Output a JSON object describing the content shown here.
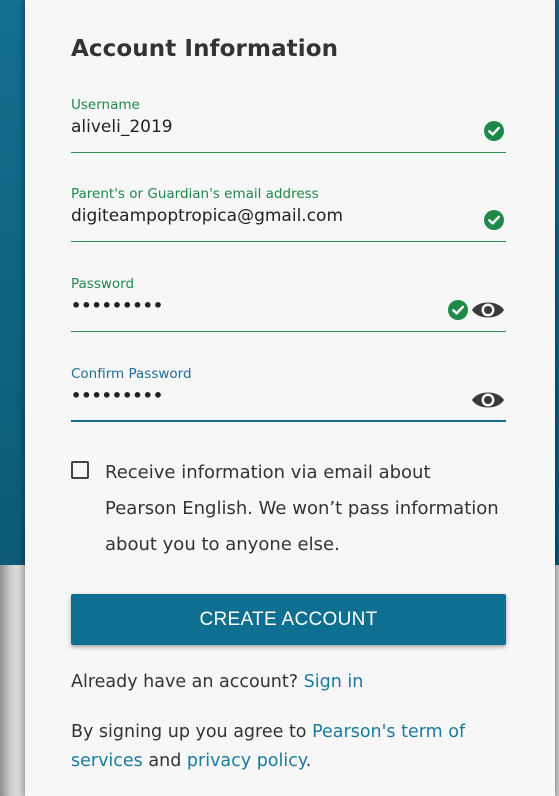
{
  "colors": {
    "accent": "#0f6f91",
    "success": "#1e8a4a",
    "link": "#1a7a9e",
    "background_teal": "#13708f",
    "card": "#f7f7f7"
  },
  "form": {
    "title": "Account Information",
    "username": {
      "label": "Username",
      "value": "aliveli_2019",
      "status_icon": "check-circle-icon"
    },
    "email": {
      "label": "Parent's or Guardian's email address",
      "value": "digiteampoptropica@gmail.com",
      "status_icon": "check-circle-icon"
    },
    "password": {
      "label": "Password",
      "value": "•••••••••",
      "status_icon": "check-circle-icon",
      "toggle_icon": "eye-icon"
    },
    "confirm_password": {
      "label": "Confirm Password",
      "value": "•••••••••",
      "toggle_icon": "eye-icon"
    },
    "opt_in": {
      "checked": false,
      "text": "Receive information via email about Pearson English. We won’t pass information about you to anyone else."
    },
    "create_button": "CREATE ACCOUNT",
    "signin": {
      "prompt": "Already have an account?",
      "link": "Sign in"
    },
    "terms": {
      "prefix": "By signing up you agree to",
      "terms_link": "Pearson's term of services",
      "and": "and",
      "privacy_link": "privacy policy",
      "suffix": "."
    }
  }
}
